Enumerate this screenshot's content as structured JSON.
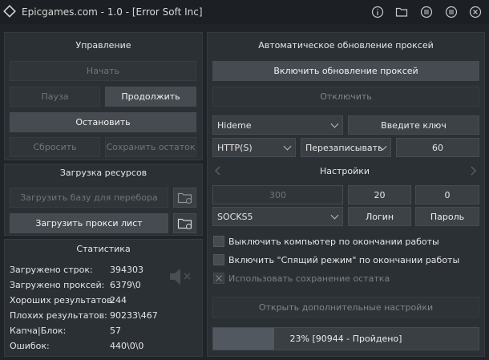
{
  "window": {
    "title": "Epicgames.com - 1.0 - [Error Soft Inc]",
    "icons": [
      "info-icon",
      "folder-icon",
      "list-icon",
      "menu-icon",
      "close-icon"
    ]
  },
  "management": {
    "heading": "Управление",
    "start": "Начать",
    "pause": "Пауза",
    "continue": "Продолжить",
    "stop": "Остановить",
    "reset": "Сбросить",
    "save_rest": "Сохранить остаток"
  },
  "resources": {
    "heading": "Загрузка ресурсов",
    "load_base": "Загрузить базу для перебора",
    "load_proxy": "Загрузить прокси лист"
  },
  "stats": {
    "heading": "Статистика",
    "rows": [
      {
        "label": "Загружено строк:",
        "value": "394303"
      },
      {
        "label": "Загружено проксей:",
        "value": "6379\\0"
      },
      {
        "label": "Хороших результатов:",
        "value": "244"
      },
      {
        "label": "Плохих результатов:",
        "value": "90233\\467"
      },
      {
        "label": "Капча|Блок:",
        "value": "57"
      },
      {
        "label": "Ошибок:",
        "value": "440\\0\\0"
      }
    ]
  },
  "proxy_update": {
    "heading": "Автоматическое обновление проксей",
    "enable": "Включить обновление проксей",
    "disable": "Отключить",
    "source": "Hideme",
    "key_placeholder": "Введите ключ",
    "protocol": "HTTP(S)",
    "mode": "Перезаписывать",
    "interval": "60"
  },
  "settings": {
    "heading": "Настройки",
    "threads": "300",
    "timeout": "20",
    "retries": "0",
    "proxy_type": "SOCKS5",
    "login": "Логин",
    "password": "Пароль",
    "checkboxes": [
      {
        "label": "Выключить компьютер по окончании работы",
        "checked": false,
        "enabled": true
      },
      {
        "label": "Включить \"Спящий режим\" по окончании работы",
        "checked": false,
        "enabled": true
      },
      {
        "label": "Использовать сохранение остатка",
        "checked": true,
        "enabled": false
      }
    ],
    "more_settings": "Открыть дополнительные настройки"
  },
  "progress": {
    "text": "23% [90944 - Пройдено]",
    "fraction": 0.23
  },
  "colors": {
    "background": "#202428",
    "panel": "#2b3035",
    "button": "#3d4247",
    "text": "#e6e6e6",
    "disabled_text": "#707579"
  }
}
